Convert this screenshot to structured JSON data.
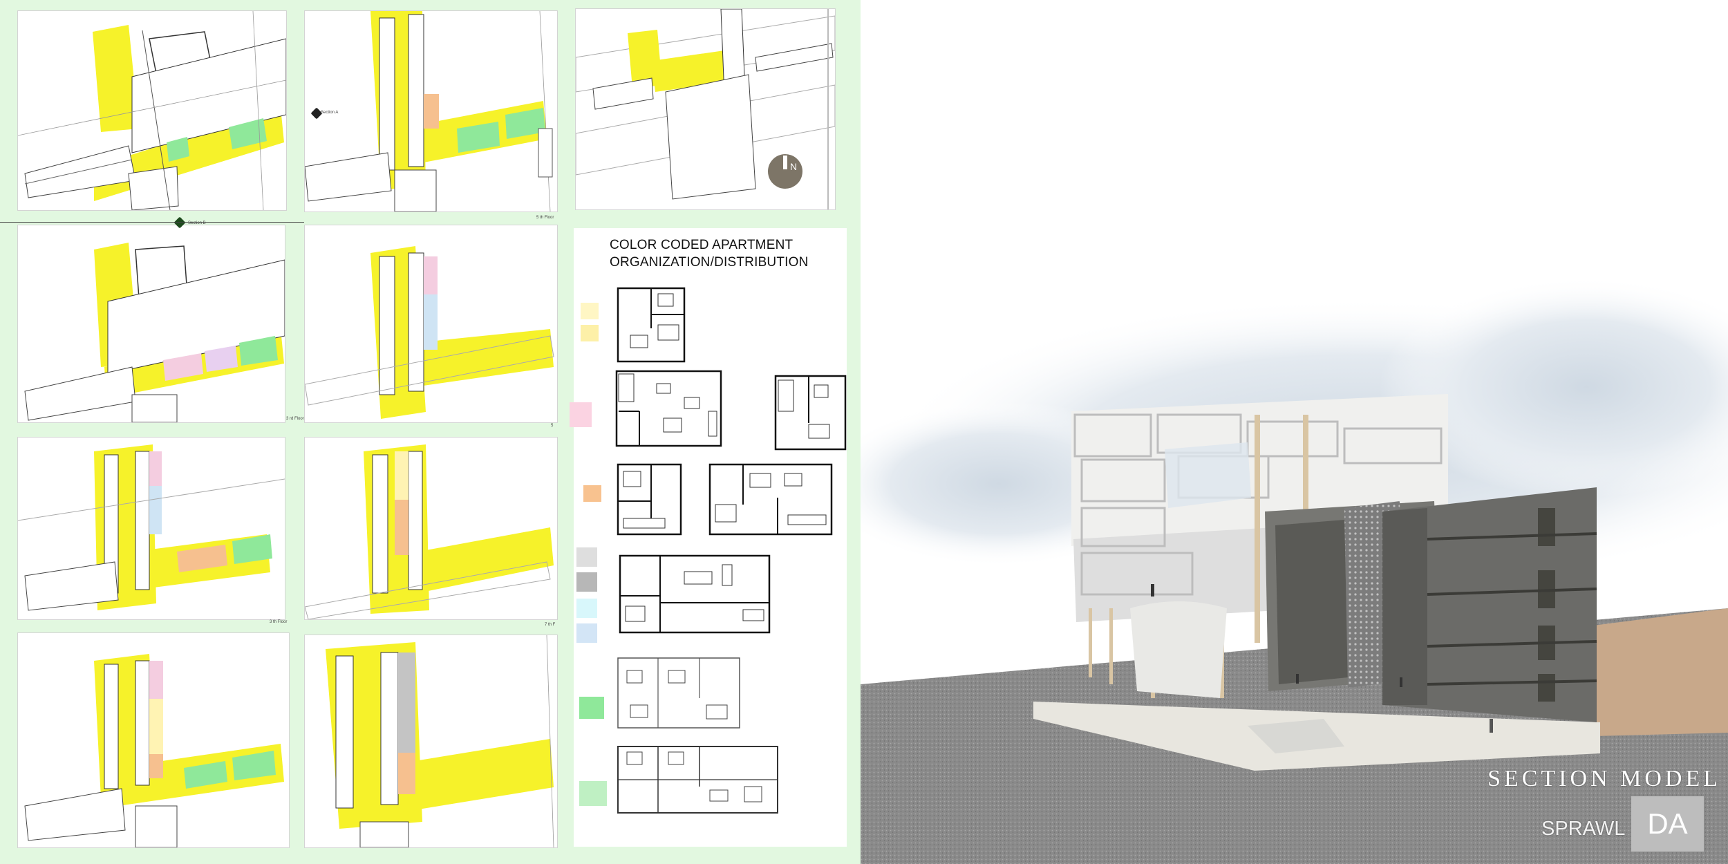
{
  "floor_labels": {
    "label_a": "5 th Floor",
    "label_b": "3 rd Floor",
    "label_c": "5",
    "label_d": "3 th Floor",
    "label_e": "7 th F"
  },
  "section_markers": {
    "section_a": "Section A",
    "section_b": "Section B"
  },
  "north_arrow": "N",
  "legend": {
    "title_line1": "COLOR CODED APARTMENT",
    "title_line2": "ORGANIZATION/DISTRIBUTION"
  },
  "model": {
    "section_label": "SECTION MODEL",
    "sprawl_label": "SPRAWL",
    "badge": "DA"
  },
  "colors": {
    "panel_green": "#e2f8e0",
    "highlight_yellow": "#f6f22a",
    "unit_green": "#8fe89a",
    "unit_pink": "#f4cde0",
    "unit_orange": "#f6c08f",
    "unit_blue": "#cfe4f4",
    "unit_cyan": "#d6f8fb",
    "unit_gray": "#c4c4c4",
    "unit_lightyellow": "#fff3b3",
    "concrete_gray": "#6b6b68",
    "north_circle": "#7d7567"
  },
  "legend_swatches": [
    {
      "name": "swatch-pale-yellow-1",
      "color": "#fff6c4"
    },
    {
      "name": "swatch-pale-yellow-2",
      "color": "#fdf0a8"
    },
    {
      "name": "swatch-pink",
      "color": "#fbd3e2"
    },
    {
      "name": "swatch-orange",
      "color": "#f8c28f"
    },
    {
      "name": "swatch-light-gray",
      "color": "#dedede"
    },
    {
      "name": "swatch-gray",
      "color": "#b7b7b7"
    },
    {
      "name": "swatch-cyan",
      "color": "#d8f7fb"
    },
    {
      "name": "swatch-light-blue",
      "color": "#d3e5f6"
    },
    {
      "name": "swatch-green",
      "color": "#8fe89a"
    },
    {
      "name": "swatch-light-green",
      "color": "#bff0c3"
    }
  ]
}
